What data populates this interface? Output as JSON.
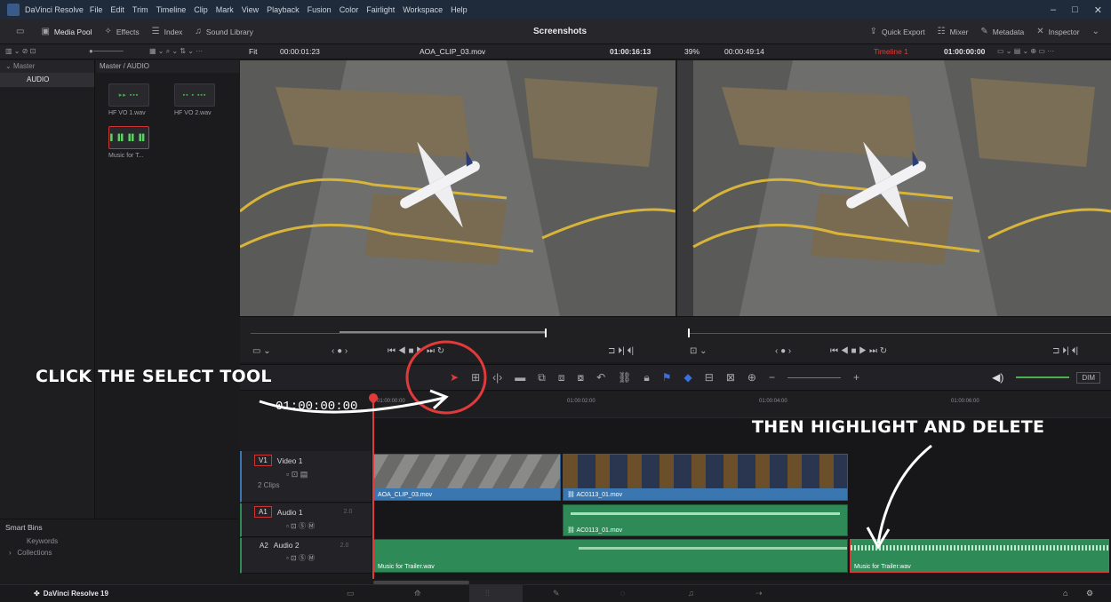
{
  "menu": {
    "app": "DaVinci Resolve",
    "items": [
      "File",
      "Edit",
      "Trim",
      "Timeline",
      "Clip",
      "Mark",
      "View",
      "Playback",
      "Fusion",
      "Color",
      "Fairlight",
      "Workspace",
      "Help"
    ]
  },
  "toolbar": {
    "media_pool": "Media Pool",
    "effects": "Effects",
    "index": "Index",
    "sound_library": "Sound Library",
    "project_title": "Screenshots",
    "quick_export": "Quick Export",
    "mixer": "Mixer",
    "metadata": "Metadata",
    "inspector": "Inspector"
  },
  "viewer_bar": {
    "fit": "Fit",
    "source_duration": "00:00:01:23",
    "source_clip": "AOA_CLIP_03.mov",
    "source_tc": "01:00:16:13",
    "zoom": "39%",
    "timeline_duration": "00:00:49:14",
    "timeline_name": "Timeline 1",
    "timeline_tc": "01:00:00:00"
  },
  "bins": {
    "root": "Master",
    "selected": "AUDIO",
    "smart_bins": "Smart Bins",
    "keywords": "Keywords",
    "collections": "Collections"
  },
  "pool": {
    "path": "Master / AUDIO",
    "clips": [
      "HF VO 1.wav",
      "HF VO 2.wav",
      "Music for T..."
    ]
  },
  "timeline": {
    "timecode": "01:00:00:00",
    "ruler": [
      "01:00:00:00",
      "01:00:02:00",
      "01:00:04:00",
      "01:00:06:00"
    ],
    "tracks": {
      "v1": {
        "id": "V1",
        "name": "Video 1",
        "count": "2 Clips"
      },
      "a1": {
        "id": "A1",
        "name": "Audio 1",
        "ch": "2.0"
      },
      "a2": {
        "id": "A2",
        "name": "Audio 2",
        "ch": "2.0"
      }
    },
    "clips": {
      "v1_a": "AOA_CLIP_03.mov",
      "v1_b": "AC0113_01.mov",
      "a1": "AC0113_01.mov",
      "a2_a": "Music for Trailer.wav",
      "a2_b": "Music for Trailer.wav"
    },
    "dim": "DIM"
  },
  "annotations": {
    "left": "CLICK THE SELECT TOOL",
    "right": "THEN HIGHLIGHT AND DELETE"
  },
  "status": {
    "version": "DaVinci Resolve 19"
  },
  "colors": {
    "accent_red": "#e23a3a",
    "video_clip": "#3a76b0",
    "audio_clip": "#2e8b57"
  }
}
